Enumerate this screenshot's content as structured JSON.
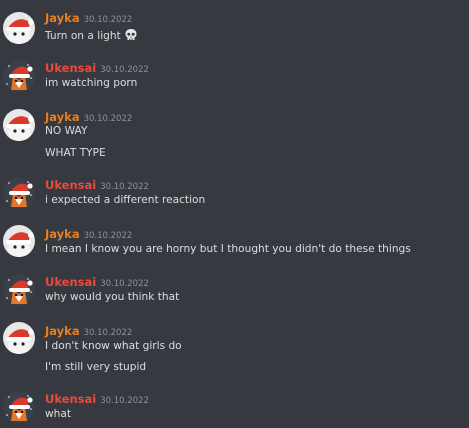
{
  "users": {
    "jayka": {
      "name": "Jayka",
      "color": "#e67e22"
    },
    "ukensai": {
      "name": "Ukensai",
      "color": "#e74c3c"
    }
  },
  "messages": [
    {
      "user": "Jayka",
      "time": "30.10.2022",
      "lines": [
        "Turn on a light"
      ],
      "emoji": "skull-icon"
    },
    {
      "user": "Ukensai",
      "time": "30.10.2022",
      "lines": [
        "im watching porn"
      ]
    },
    {
      "user": "Jayka",
      "time": "30.10.2022",
      "lines": [
        "NO WAY",
        "WHAT TYPE"
      ]
    },
    {
      "user": "Ukensai",
      "time": "30.10.2022",
      "lines": [
        "i expected a different reaction"
      ]
    },
    {
      "user": "Jayka",
      "time": "30.10.2022",
      "lines": [
        "I mean I know you are horny but I thought you didn't do these things"
      ]
    },
    {
      "user": "Ukensai",
      "time": "30.10.2022",
      "lines": [
        "why would you think that"
      ]
    },
    {
      "user": "Jayka",
      "time": "30.10.2022",
      "lines": [
        "I don't know what girls do",
        "I'm still very stupid"
      ]
    },
    {
      "user": "Ukensai",
      "time": "30.10.2022",
      "lines": [
        "what"
      ]
    }
  ]
}
